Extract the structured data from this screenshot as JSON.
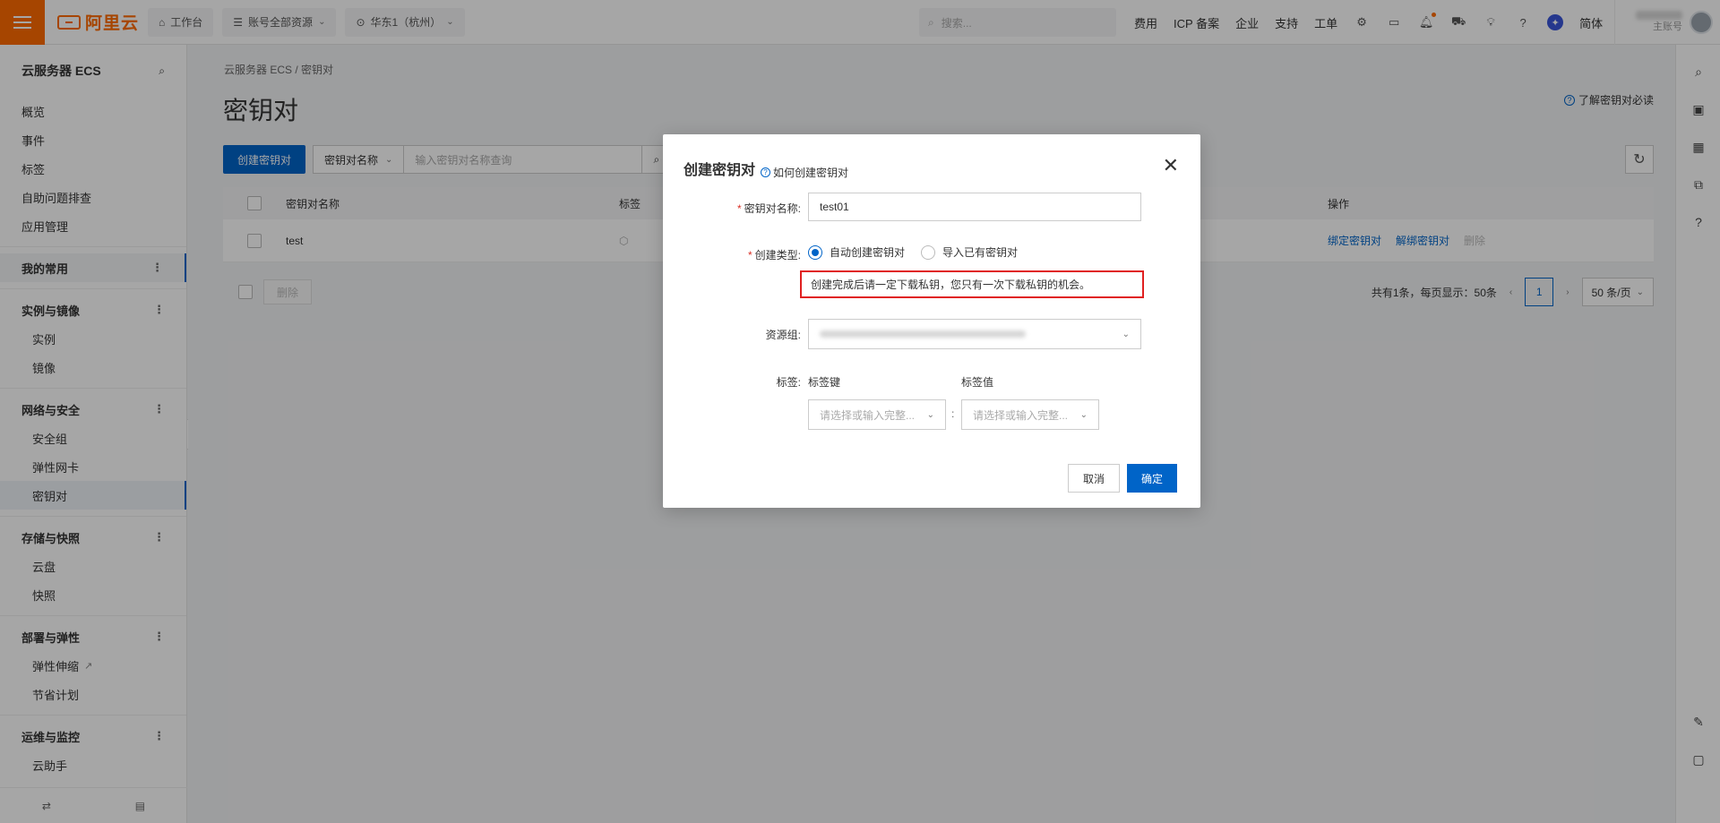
{
  "topbar": {
    "logo_text": "阿里云",
    "workbench": "工作台",
    "resource_scope": "账号全部资源",
    "region": "华东1（杭州）",
    "search_placeholder": "搜索...",
    "links": [
      "费用",
      "ICP 备案",
      "企业",
      "支持",
      "工单"
    ],
    "lang": "简体",
    "account_role": "主账号"
  },
  "sidebar": {
    "title": "云服务器 ECS",
    "top_items": [
      "概览",
      "事件",
      "标签",
      "自助问题排查",
      "应用管理"
    ],
    "favorites": "我的常用",
    "groups": [
      {
        "label": "实例与镜像",
        "items": [
          "实例",
          "镜像"
        ]
      },
      {
        "label": "网络与安全",
        "items": [
          "安全组",
          "弹性网卡",
          "密钥对"
        ]
      },
      {
        "label": "存储与快照",
        "items": [
          "云盘",
          "快照"
        ]
      },
      {
        "label": "部署与弹性",
        "items": [
          "弹性伸缩",
          "节省计划"
        ]
      },
      {
        "label": "运维与监控",
        "items": [
          "云助手"
        ]
      }
    ],
    "active_item": "密钥对"
  },
  "content": {
    "breadcrumb": "云服务器 ECS  /  密钥对",
    "title": "密钥对",
    "help_link": "了解密钥对必读",
    "create_button": "创建密钥对",
    "filter_field": "密钥对名称",
    "filter_placeholder": "输入密钥对名称查询",
    "columns": [
      "密钥对名称",
      "标签",
      "操作"
    ],
    "rows": [
      {
        "name": "test",
        "actions": [
          "绑定密钥对",
          "解绑密钥对",
          "删除"
        ]
      }
    ],
    "delete_button": "删除",
    "pager_summary": "共有1条，每页显示：50条",
    "current_page": "1",
    "page_size": "50 条/页"
  },
  "modal": {
    "title": "创建密钥对",
    "help": "如何创建密钥对",
    "name_label": "密钥对名称:",
    "name_value": "test01",
    "type_label": "创建类型:",
    "type_options": [
      "自动创建密钥对",
      "导入已有密钥对"
    ],
    "type_selected": "自动创建密钥对",
    "warning": "创建完成后请一定下载私钥，您只有一次下载私钥的机会。",
    "resource_group_label": "资源组:",
    "tag_label": "标签:",
    "tag_key_label": "标签键",
    "tag_value_label": "标签值",
    "tag_key_placeholder": "请选择或输入完整...",
    "tag_value_placeholder": "请选择或输入完整...",
    "cancel": "取消",
    "confirm": "确定"
  },
  "colors": {
    "brand": "#ff6a00",
    "primary": "#0064c8",
    "warning_border": "#e02020"
  }
}
